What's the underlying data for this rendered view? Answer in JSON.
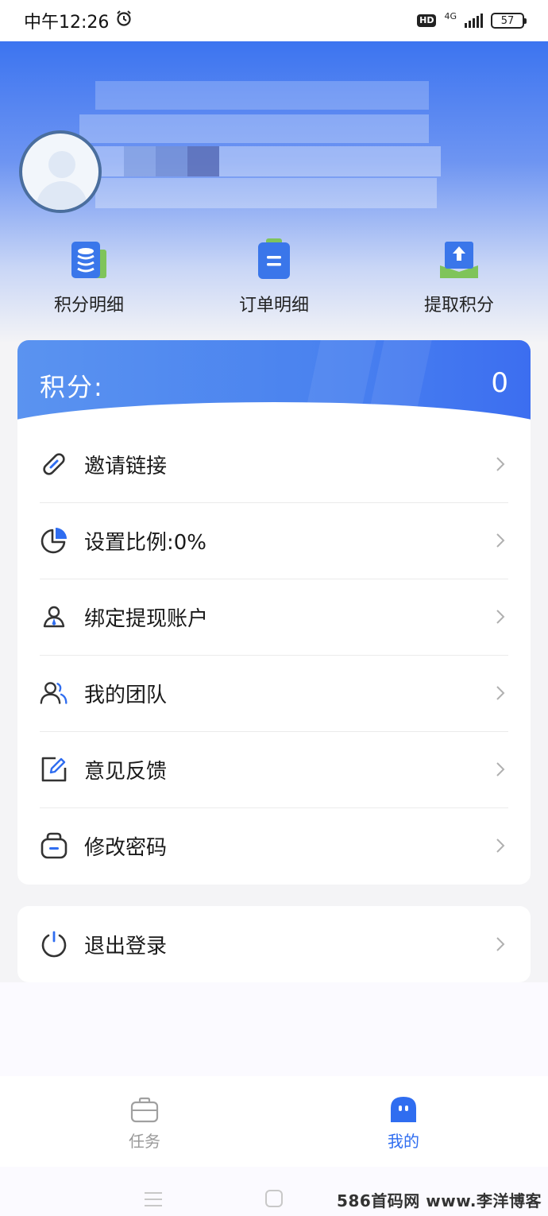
{
  "status_bar": {
    "time": "中午12:26",
    "hd": "HD",
    "network": "4G",
    "battery": "57"
  },
  "header": {
    "quick_actions": [
      {
        "label": "积分明细",
        "icon": "database-icon"
      },
      {
        "label": "订单明细",
        "icon": "clipboard-icon"
      },
      {
        "label": "提取积分",
        "icon": "upload-icon"
      }
    ]
  },
  "points": {
    "label": "积分:",
    "value": "0"
  },
  "menu": {
    "items": [
      {
        "label": "邀请链接",
        "icon": "link-icon"
      },
      {
        "label": "设置比例:0%",
        "icon": "pie-chart-icon"
      },
      {
        "label": "绑定提现账户",
        "icon": "account-icon"
      },
      {
        "label": "我的团队",
        "icon": "team-icon"
      },
      {
        "label": "意见反馈",
        "icon": "edit-icon"
      },
      {
        "label": "修改密码",
        "icon": "lock-icon"
      }
    ],
    "logout": {
      "label": "退出登录",
      "icon": "power-icon"
    }
  },
  "tabs": [
    {
      "label": "任务",
      "icon": "briefcase-icon",
      "active": false
    },
    {
      "label": "我的",
      "icon": "ghost-icon",
      "active": true
    }
  ],
  "colors": {
    "accent": "#3c74f0",
    "tab_active": "#2f6df0",
    "tab_inactive": "#9a9a9a"
  },
  "watermark": "586首码网 www.李洋博客"
}
